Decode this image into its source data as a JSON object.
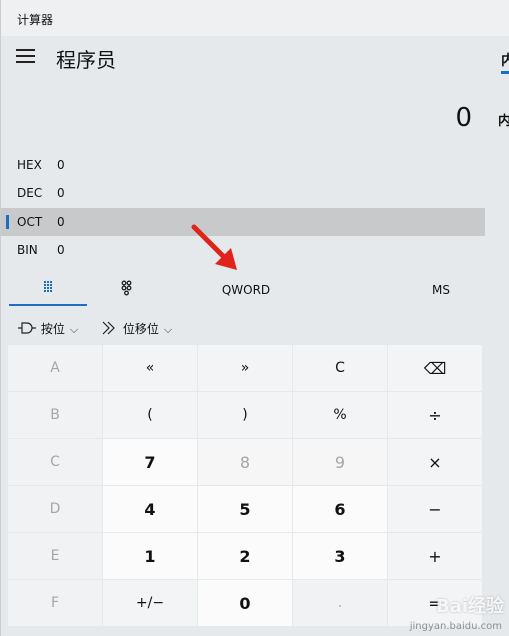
{
  "window": {
    "title": "计算器"
  },
  "header": {
    "mode_title": "程序员",
    "right_tab": "内",
    "right_memory_label": "内"
  },
  "display": {
    "value": "0"
  },
  "radix": [
    {
      "label": "HEX",
      "value": "0",
      "selected": false
    },
    {
      "label": "DEC",
      "value": "0",
      "selected": false
    },
    {
      "label": "OCT",
      "value": "0",
      "selected": true
    },
    {
      "label": "BIN",
      "value": "0",
      "selected": false
    }
  ],
  "toolbar": {
    "keypad_icon": "full-keypad-icon",
    "bits_icon": "bit-toggling-keypad-icon",
    "word_size": "QWORD",
    "memory_store": "MS"
  },
  "dropdowns": {
    "bitwise": {
      "label": "按位",
      "icon": "bitwise-gate-icon"
    },
    "bitshift": {
      "label": "位移位",
      "icon": "bit-shift-icon"
    }
  },
  "keys": [
    [
      "A",
      "«",
      "»",
      "C",
      "⌫"
    ],
    [
      "B",
      "(",
      ")",
      "%",
      "÷"
    ],
    [
      "C",
      "7",
      "8",
      "9",
      "×"
    ],
    [
      "D",
      "4",
      "5",
      "6",
      "−"
    ],
    [
      "E",
      "1",
      "2",
      "3",
      "+"
    ],
    [
      "F",
      "+/−",
      "0",
      ".",
      "="
    ]
  ],
  "watermark": {
    "text": "Bai经验",
    "url": "jingyan.baidu.com"
  },
  "colors": {
    "accent": "#1b6ec2",
    "arrow": "#e0241b"
  }
}
